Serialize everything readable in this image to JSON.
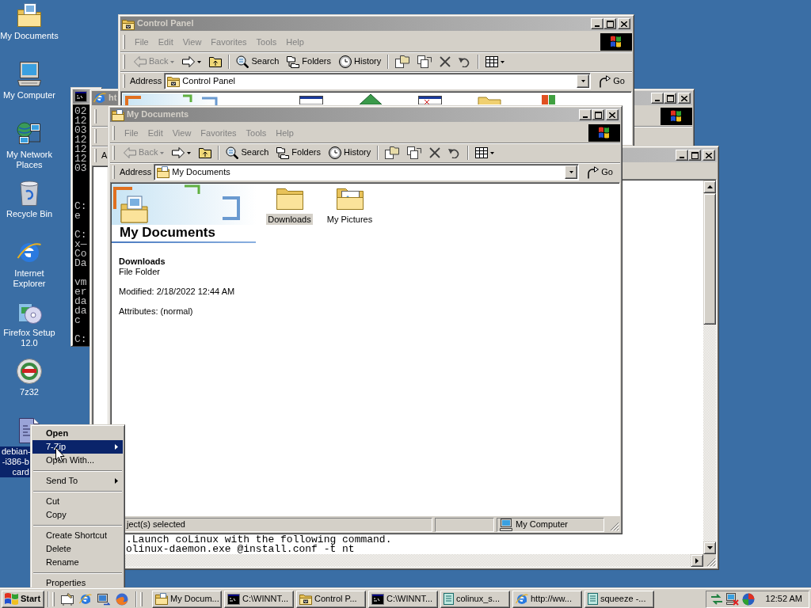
{
  "desktop_icons": [
    {
      "label": "My Documents",
      "kind": "documents",
      "selected": false
    },
    {
      "label": "My Computer",
      "kind": "computer",
      "selected": false
    },
    {
      "label": "My Network Places",
      "kind": "network",
      "selected": false
    },
    {
      "label": "Recycle Bin",
      "kind": "recycle",
      "selected": false
    },
    {
      "label": "Internet Explorer",
      "kind": "browser",
      "selected": false
    },
    {
      "label": "Firefox Setup 12.0",
      "kind": "installer",
      "selected": false
    },
    {
      "label": "7z32",
      "kind": "disc",
      "selected": false
    },
    {
      "lines": [
        "debian-",
        "-i386-b",
        "card"
      ],
      "kind": "file",
      "selected": true
    }
  ],
  "console_window": {
    "active": false,
    "blocks": [
      [
        "02",
        "12",
        "03",
        "12",
        "12",
        "12",
        "03"
      ],
      [
        "C:",
        "e"
      ],
      [
        "C:",
        "x—",
        "Co",
        "Da"
      ],
      [
        "vm",
        "er",
        "da",
        "da",
        "c"
      ],
      [
        "C:"
      ]
    ]
  },
  "browser_window": {
    "active": false,
    "title": "ht",
    "address_label": "A"
  },
  "control_panel_window": {
    "active": false,
    "title": "Control Panel",
    "menu": [
      "File",
      "Edit",
      "View",
      "Favorites",
      "Tools",
      "Help"
    ],
    "toolbar": [
      [
        {
          "kind": "back",
          "label": "Back",
          "disabled": true
        },
        {
          "kind": "forward",
          "disabled": false
        },
        {
          "kind": "up",
          "disabled": false
        }
      ],
      [
        {
          "kind": "search",
          "label": "Search",
          "disabled": false
        },
        {
          "kind": "folders",
          "label": "Folders",
          "disabled": false
        },
        {
          "kind": "history",
          "label": "History",
          "disabled": false
        }
      ],
      [
        {
          "kind": "move",
          "disabled": false
        },
        {
          "kind": "copy",
          "disabled": false
        },
        {
          "kind": "delete",
          "disabled": false
        },
        {
          "kind": "undo",
          "disabled": false
        }
      ],
      [
        {
          "kind": "views",
          "disabled": false
        }
      ]
    ],
    "address_label": "Address",
    "address": "Control Panel",
    "go": "Go"
  },
  "editor_window": {
    "active": false,
    "lines": [
      ".Launch coLinux with the following command.",
      "olinux-daemon.exe @install.conf -t nt"
    ]
  },
  "my_documents_window": {
    "active": false,
    "title": "My Documents",
    "menu": [
      "File",
      "Edit",
      "View",
      "Favorites",
      "Tools",
      "Help"
    ],
    "toolbar": [
      [
        {
          "kind": "back",
          "label": "Back",
          "disabled": true
        },
        {
          "kind": "forward",
          "disabled": false
        },
        {
          "kind": "up",
          "disabled": false
        }
      ],
      [
        {
          "kind": "search",
          "label": "Search",
          "disabled": false
        },
        {
          "kind": "folders",
          "label": "Folders",
          "disabled": false
        },
        {
          "kind": "history",
          "label": "History",
          "disabled": false
        }
      ],
      [
        {
          "kind": "move",
          "disabled": false
        },
        {
          "kind": "copy",
          "disabled": false
        },
        {
          "kind": "delete",
          "disabled": false
        },
        {
          "kind": "undo",
          "disabled": false
        }
      ],
      [
        {
          "kind": "views",
          "disabled": false
        }
      ]
    ],
    "address_label": "Address",
    "address": "My Documents",
    "go": "Go",
    "panel": {
      "title": "My Documents",
      "name": "Downloads",
      "type": "File Folder",
      "modified": "Modified: 2/18/2022 12:44 AM",
      "attributes": "Attributes: (normal)"
    },
    "items": [
      {
        "label": "Downloads",
        "kind": "folder",
        "selected": true
      },
      {
        "label": "My Pictures",
        "kind": "pictures",
        "selected": false
      }
    ],
    "status": {
      "text": "ject(s) selected",
      "zone": "My Computer"
    }
  },
  "context_menu": {
    "groups": [
      [
        {
          "label": "Open",
          "default": true,
          "submenu": false,
          "selected": false
        },
        {
          "label": "7-Zip",
          "default": false,
          "submenu": true,
          "selected": true
        },
        {
          "label": "Open With...",
          "default": false,
          "submenu": false,
          "selected": false
        }
      ],
      [
        {
          "label": "Send To",
          "default": false,
          "submenu": true,
          "selected": false
        }
      ],
      [
        {
          "label": "Cut",
          "default": false,
          "submenu": false,
          "selected": false
        },
        {
          "label": "Copy",
          "default": false,
          "submenu": false,
          "selected": false
        }
      ],
      [
        {
          "label": "Create Shortcut",
          "default": false,
          "submenu": false,
          "selected": false
        },
        {
          "label": "Delete",
          "default": false,
          "submenu": false,
          "selected": false
        },
        {
          "label": "Rename",
          "default": false,
          "submenu": false,
          "selected": false
        }
      ],
      [
        {
          "label": "Properties",
          "default": false,
          "submenu": false,
          "selected": false
        }
      ]
    ]
  },
  "taskbar": {
    "start": "Start",
    "tasks": [
      {
        "label": "My Docum...",
        "kind": "docs",
        "selected": false
      },
      {
        "label": "C:\\WINNT...",
        "kind": "console",
        "selected": false
      },
      {
        "label": "Control P...",
        "kind": "control",
        "selected": false
      },
      {
        "label": "C:\\WINNT...",
        "kind": "console",
        "selected": false
      },
      {
        "label": "colinux_s...",
        "kind": "notepad",
        "selected": false
      },
      {
        "label": "http://ww...",
        "kind": "browser",
        "selected": false
      },
      {
        "label": "squeeze -...",
        "kind": "notepad",
        "selected": false
      }
    ],
    "clock": "12:52 AM"
  }
}
